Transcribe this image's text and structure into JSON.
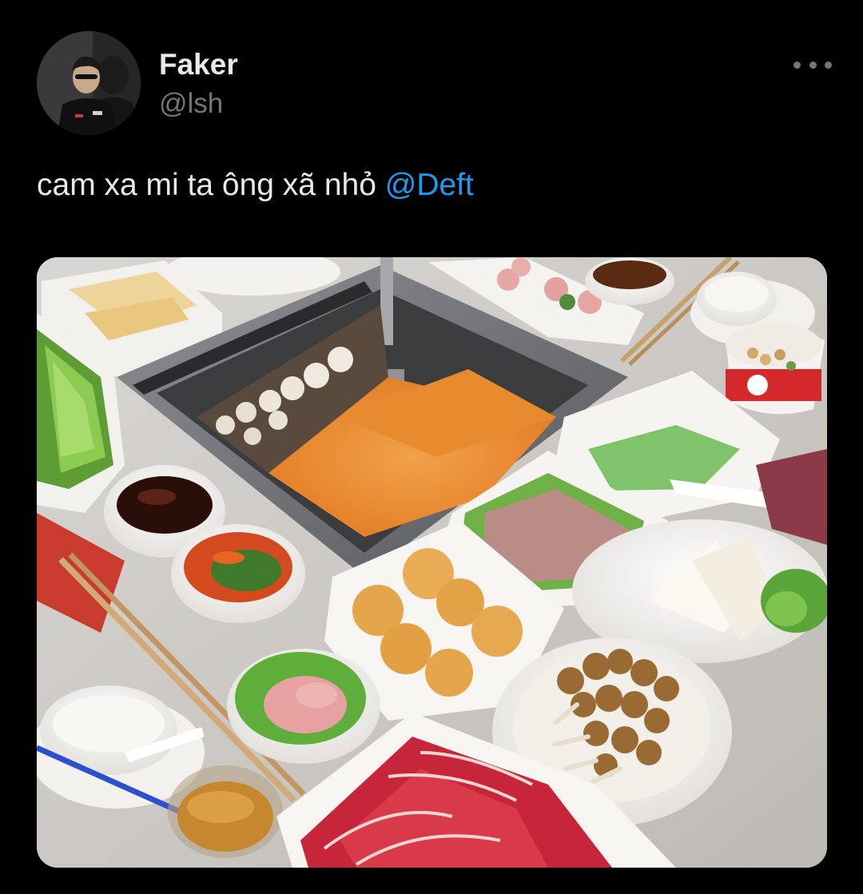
{
  "author": {
    "display_name": "Faker",
    "handle": "@lsh",
    "avatar_icon": "profile-photo"
  },
  "tweet": {
    "text_before_mention": "cam xa mi ta ông xã nhỏ ",
    "mention": "@Deft"
  },
  "menu": {
    "icon": "more-options-icon"
  },
  "media": {
    "alt": "Hot pot table with dipping sauces, vegetables, fish balls, mushrooms, tofu and sliced beef"
  },
  "colors": {
    "background": "#000000",
    "text_primary": "#e7e9ea",
    "text_secondary": "#71767b",
    "link": "#1d9bf0"
  }
}
